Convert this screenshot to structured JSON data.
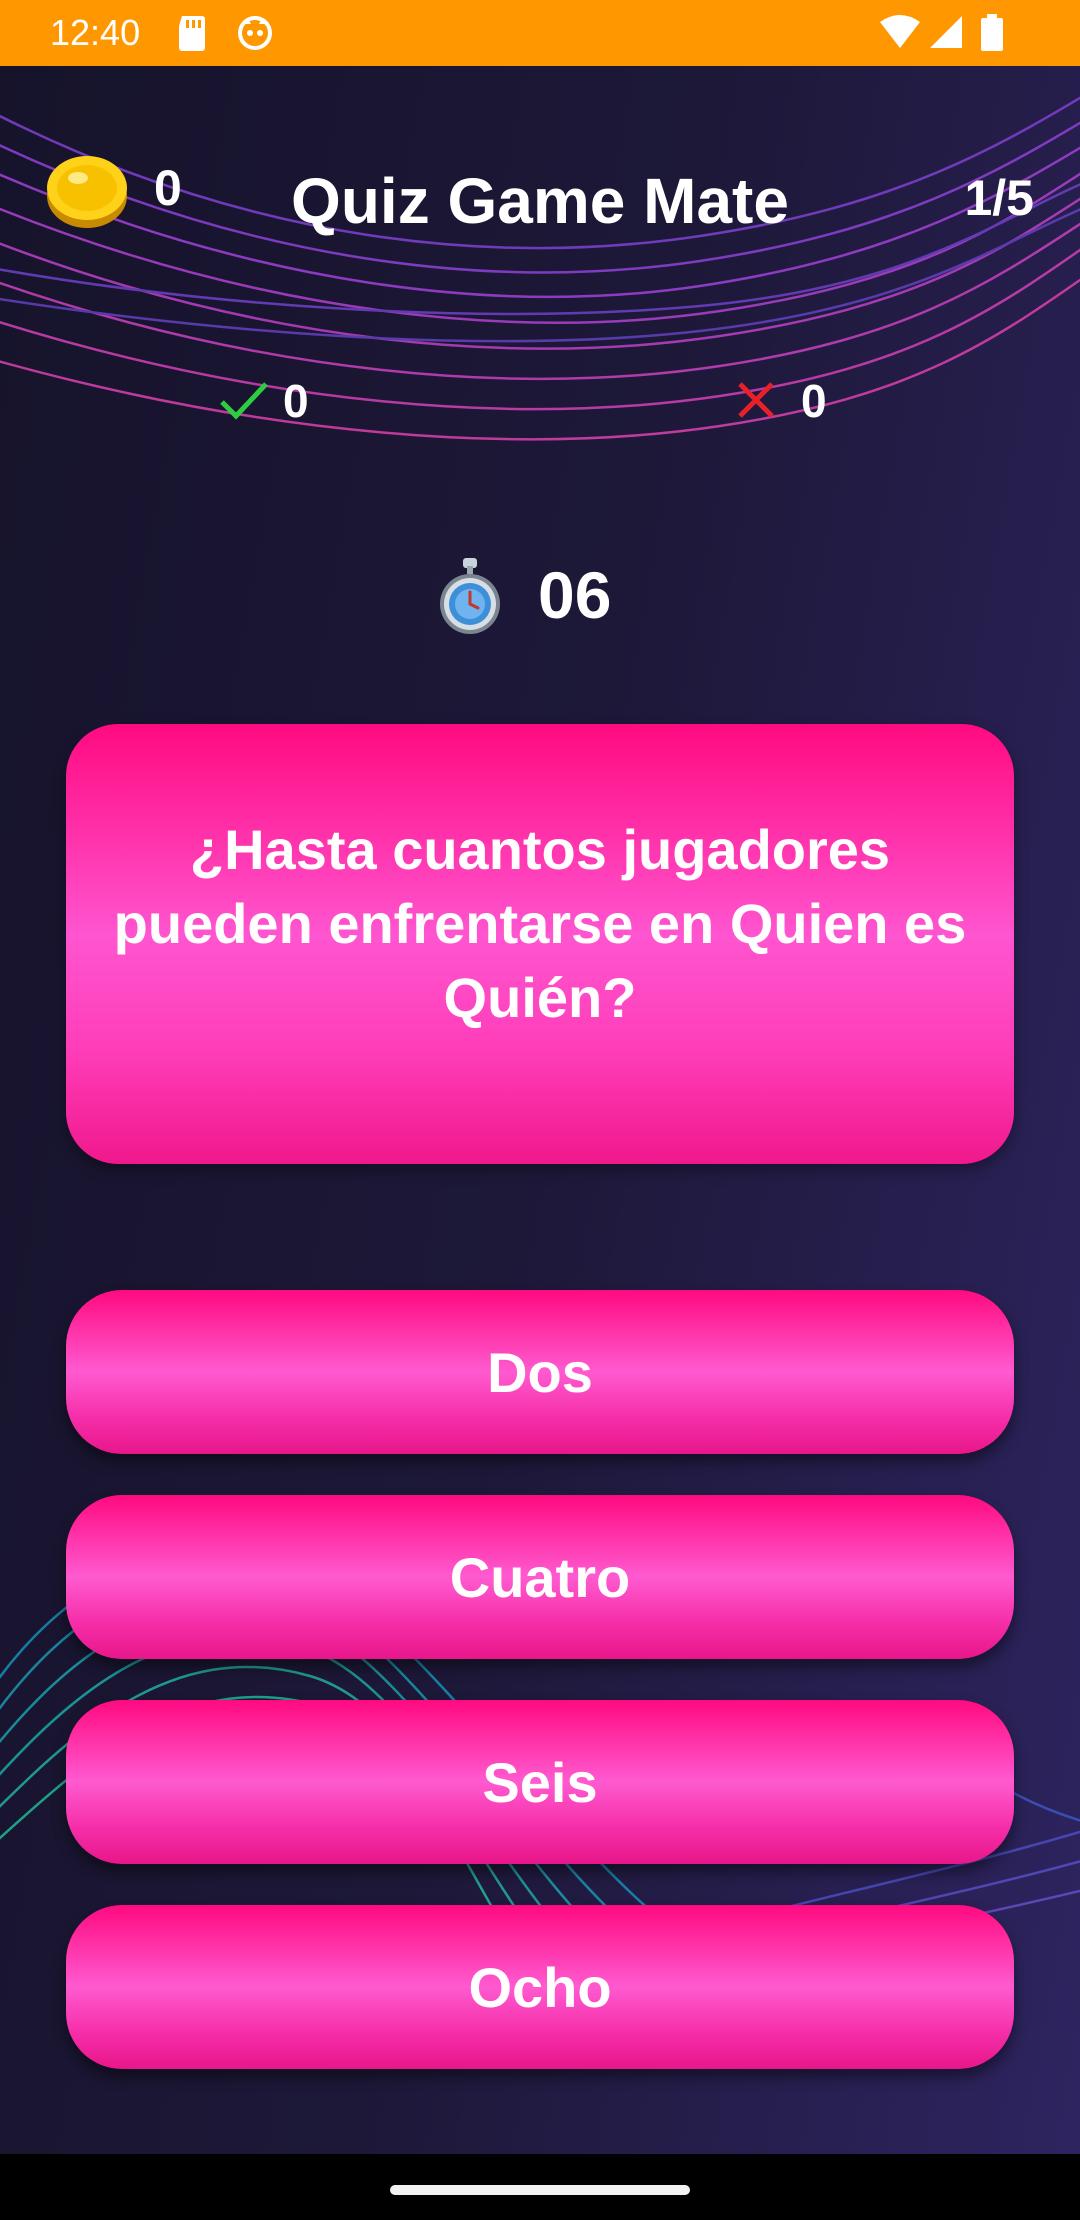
{
  "status_bar": {
    "time": "12:40",
    "icons": [
      "sd-card-icon",
      "notification-app-icon",
      "wifi-icon",
      "cell-signal-icon",
      "battery-icon"
    ]
  },
  "header": {
    "coins": "0",
    "title": "Quiz Game Mate",
    "progress": "1/5"
  },
  "score": {
    "correct": "0",
    "wrong": "0"
  },
  "timer": {
    "seconds": "06"
  },
  "question": {
    "text": "¿Hasta cuantos jugadores pueden enfrentarse en Quien es Quién?"
  },
  "answers": [
    {
      "label": "Dos"
    },
    {
      "label": "Cuatro"
    },
    {
      "label": "Seis"
    },
    {
      "label": "Ocho"
    }
  ],
  "colors": {
    "status_bar": "#ff9800",
    "accent_pink": "#ff3cb8",
    "correct_green": "#2ecc40",
    "wrong_red": "#e8202a"
  }
}
